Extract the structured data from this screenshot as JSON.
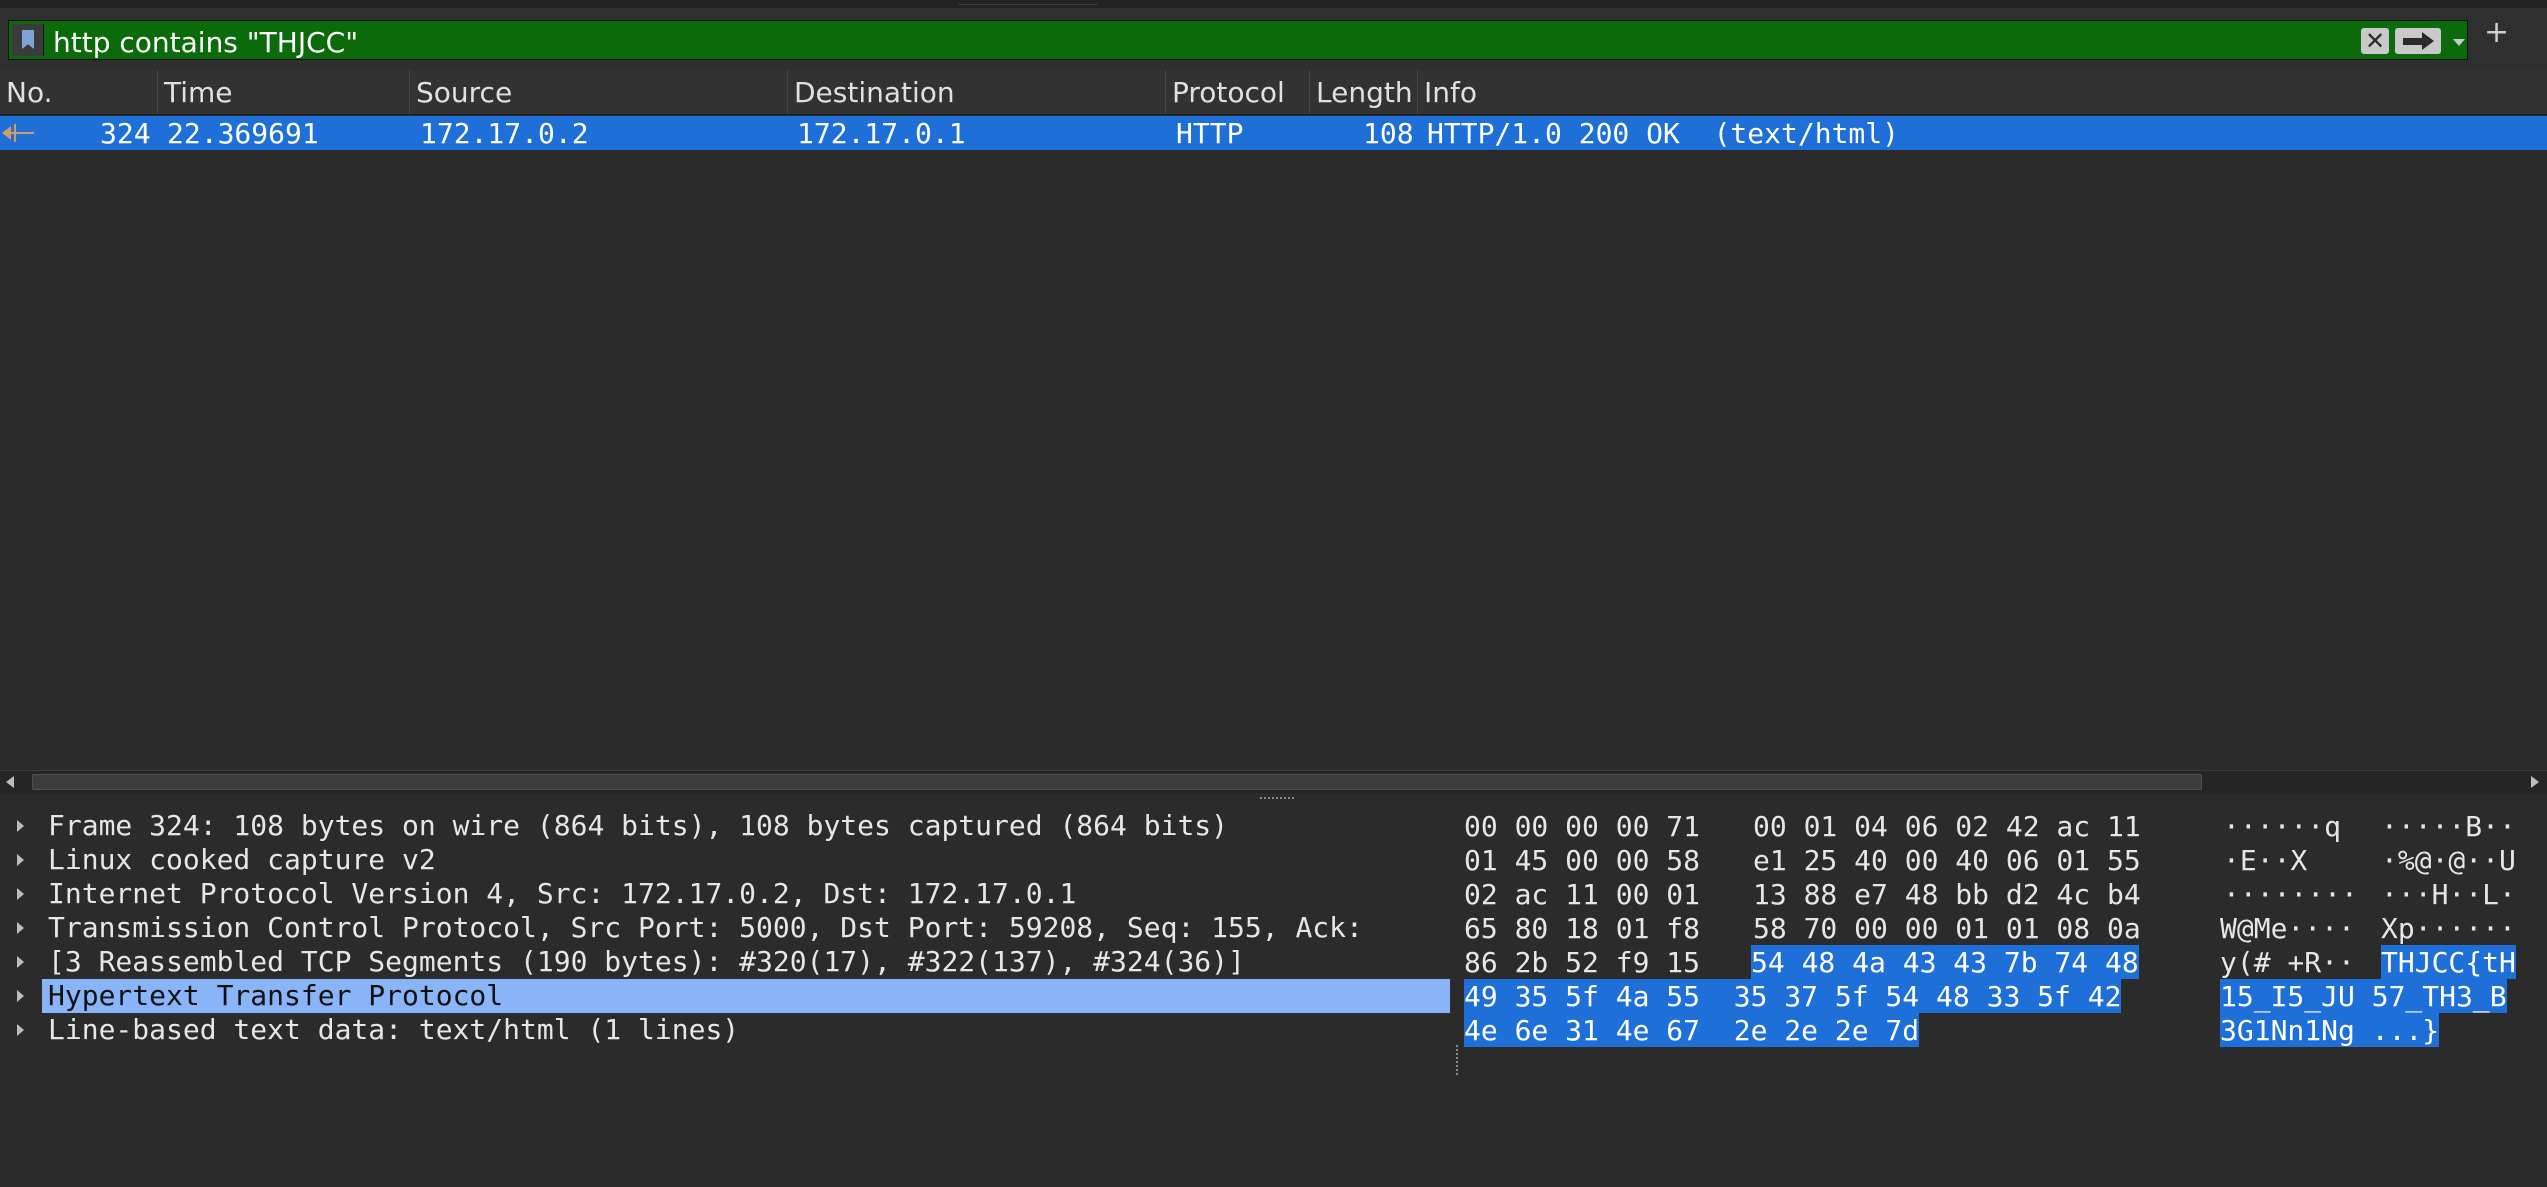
{
  "filter": {
    "text": "http contains \"THJCC\"",
    "clear_icon": "✕",
    "apply_icon": "arrow-right-icon",
    "add_label": "+",
    "color": "#0b6b0b"
  },
  "columns": {
    "no": "No.",
    "time": "Time",
    "source": "Source",
    "destination": "Destination",
    "protocol": "Protocol",
    "length": "Length",
    "info": "Info"
  },
  "packets": [
    {
      "no": "324",
      "time": "22.369691",
      "source": "172.17.0.2",
      "destination": "172.17.0.1",
      "protocol": "HTTP",
      "length": "108",
      "info": "HTTP/1.0 200 OK  (text/html)"
    }
  ],
  "details": [
    "Frame 324: 108 bytes on wire (864 bits), 108 bytes captured (864 bits)",
    "Linux cooked capture v2",
    "Internet Protocol Version 4, Src: 172.17.0.2, Dst: 172.17.0.1",
    "Transmission Control Protocol, Src Port: 5000, Dst Port: 59208, Seq: 155, Ack:",
    "[3 Reassembled TCP Segments (190 bytes): #320(17), #322(137), #324(36)]",
    "Hypertext Transfer Protocol",
    "Line-based text data: text/html (1 lines)"
  ],
  "bytes": [
    {
      "hex": [
        "00 00 00 00 71",
        "00 01 04 06 02 42 ac 11"
      ],
      "ascii": [
        "······q",
        "·····B··"
      ]
    },
    {
      "hex": [
        "01 45 00 00 58",
        "e1 25 40 00 40 06 01 55"
      ],
      "ascii": [
        "·E··X",
        "·%@·@··U"
      ]
    },
    {
      "hex": [
        "02 ac 11 00 01",
        "13 88 e7 48 bb d2 4c b4"
      ],
      "ascii": [
        "········",
        "···H··L·"
      ]
    },
    {
      "hex": [
        "65 80 18 01 f8",
        "58 70 00 00 01 01 08 0a"
      ],
      "ascii": [
        "W@Me····",
        "Xp······"
      ]
    },
    {
      "hex_plain": "86 2b 52 f9 15",
      "hex_hl": "54 48 4a 43 43 7b 74 48",
      "ascii_plain": "y(# +R··",
      "ascii_hl": "THJCC{tH"
    },
    {
      "hex_hl": "49 35 5f 4a 55  35 37 5f 54 48 33 5f 42",
      "ascii_hl": "15_I5_JU 57_TH3_B"
    },
    {
      "hex_hl": "4e 6e 31 4e 67  2e 2e 2e 7d",
      "ascii_hl": "3G1Nn1Ng ...}"
    }
  ]
}
